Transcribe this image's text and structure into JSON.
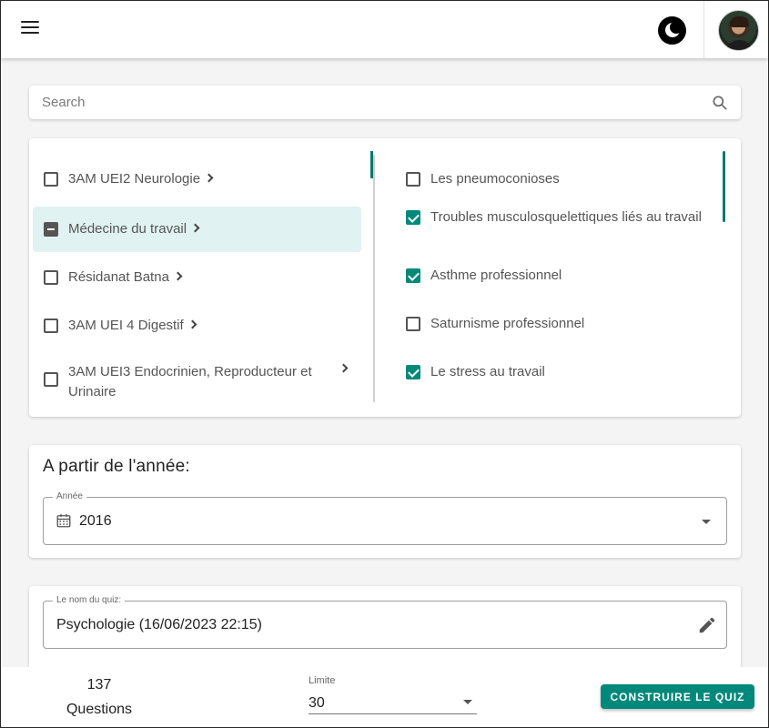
{
  "appbar": {
    "menu_icon": "menu-icon",
    "theme_icon": "moon-icon",
    "avatar": "user-avatar"
  },
  "search": {
    "placeholder": "Search",
    "value": ""
  },
  "categories": [
    {
      "label": "3AM UEI2 Neurologie",
      "state": "unchecked",
      "active": false
    },
    {
      "label": "Médecine du travail",
      "state": "indeterminate",
      "active": true
    },
    {
      "label": "Résidanat Batna",
      "state": "unchecked",
      "active": false
    },
    {
      "label": "3AM UEI 4 Digestif",
      "state": "unchecked",
      "active": false
    },
    {
      "label": "3AM UEI3 Endocrinien, Reproducteur et Urinaire",
      "state": "unchecked",
      "active": false
    }
  ],
  "topics": [
    {
      "label": "Les pneumoconioses",
      "checked": false
    },
    {
      "label": "Troubles musculosquelettiques liés au travail",
      "checked": true
    },
    {
      "label": "Asthme professionnel",
      "checked": true
    },
    {
      "label": "Saturnisme professionnel",
      "checked": false
    },
    {
      "label": "Le stress au travail",
      "checked": true
    }
  ],
  "year_section": {
    "title": "A partir de l'année:",
    "field_label": "Année",
    "value": "2016"
  },
  "quiz_name": {
    "field_label": "Le nom du quiz:",
    "value": "Psychologie (16/06/2023 22:15)"
  },
  "footer": {
    "count": "137",
    "count_label": "Questions",
    "limit_label": "Limite",
    "limit_value": "30",
    "build_button": "CONSTRUIRE LE QUIZ"
  },
  "colors": {
    "accent": "#00897b",
    "active_row": "#e0f2f1"
  }
}
